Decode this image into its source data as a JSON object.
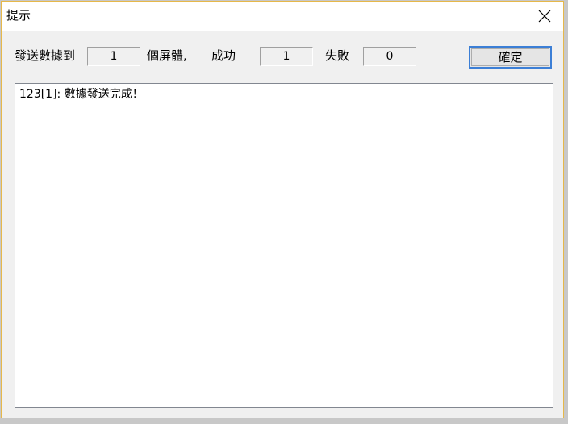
{
  "window": {
    "title": "提示"
  },
  "summary": {
    "sent_label": "發送數據到",
    "sent_value": "1",
    "screens_label": "個屏體,",
    "success_label": "成功",
    "success_value": "1",
    "fail_label": "失敗",
    "fail_value": "0",
    "ok_label": "確定"
  },
  "log": {
    "lines": [
      "123[1]: 數據發送完成！"
    ]
  },
  "icons": {
    "close": "close-icon"
  },
  "colors": {
    "border_accent": "#e6b84a",
    "button_focus": "#3c7fd6"
  }
}
